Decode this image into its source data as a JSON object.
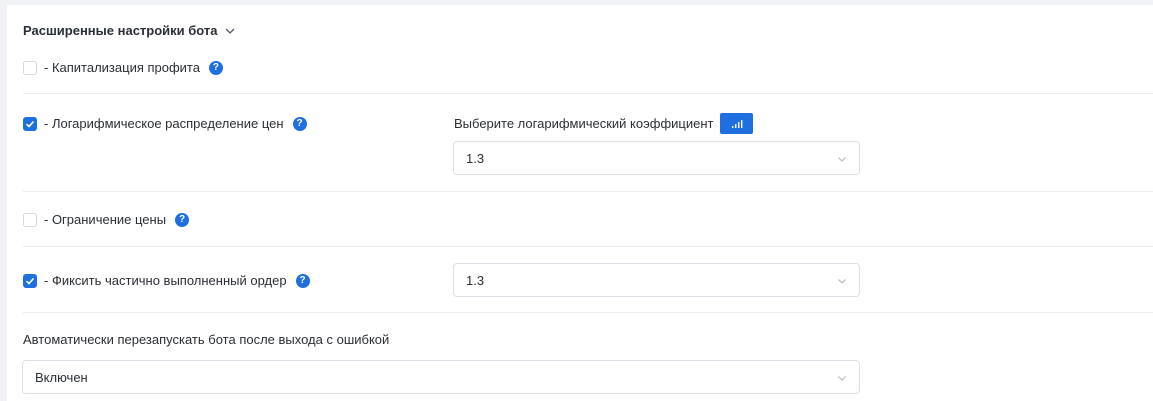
{
  "section": {
    "title": "Расширенные настройки бота",
    "toggle_icon": "chevron-down-icon"
  },
  "options": {
    "profit_capitalization": {
      "label": "- Капитализация профита",
      "checked": false,
      "help_icon": "question-icon"
    },
    "log_distribution": {
      "label": "- Логарифмическое распределение цен",
      "checked": true,
      "coef_label": "Выберите логарифмический коэффициент",
      "chart_icon": "bar-chart-icon",
      "coef_value": "1.3"
    },
    "price_limit": {
      "label": "- Ограничение цены",
      "checked": false
    },
    "fix_partial_order": {
      "label": "- Фиксить частично выполненный ордер",
      "checked": true,
      "value": "1.3"
    }
  },
  "auto_restart": {
    "label": "Автоматически перезапускать бота после выхода с ошибкой",
    "value": "Включен"
  },
  "colors": {
    "accent": "#1f6fe0",
    "border": "#dcdfe5",
    "divider": "#e9ebef"
  }
}
